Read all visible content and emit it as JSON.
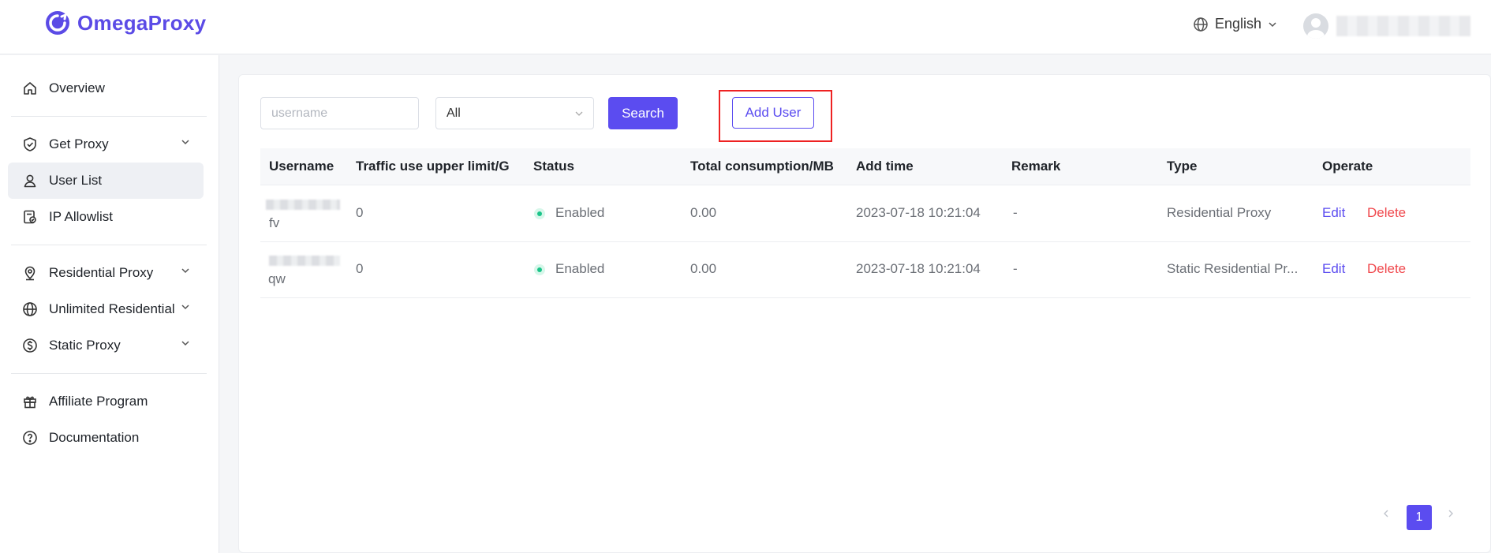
{
  "brand": {
    "name": "OmegaProxy",
    "accent": "#5b4cf0"
  },
  "header": {
    "language": "English"
  },
  "sidebar": {
    "items": [
      {
        "label": "Overview",
        "icon": "home-icon"
      },
      {
        "label": "Get Proxy",
        "icon": "shield-check-icon",
        "expandable": true
      },
      {
        "label": "User List",
        "icon": "user-icon",
        "active": true
      },
      {
        "label": "IP Allowlist",
        "icon": "ip-list-icon"
      },
      {
        "label": "Residential Proxy",
        "icon": "location-pin-icon",
        "expandable": true
      },
      {
        "label": "Unlimited Residential",
        "icon": "globe-icon",
        "expandable": true
      },
      {
        "label": "Static Proxy",
        "icon": "dollar-circle-icon",
        "expandable": true
      },
      {
        "label": "Affiliate Program",
        "icon": "gift-icon"
      },
      {
        "label": "Documentation",
        "icon": "help-circle-icon"
      }
    ]
  },
  "toolbar": {
    "search_placeholder": "username",
    "filter_value": "All",
    "search_label": "Search",
    "add_user_label": "Add User"
  },
  "table": {
    "columns": [
      "Username",
      "Traffic use upper limit/G",
      "Status",
      "Total consumption/MB",
      "Add time",
      "Remark",
      "Type",
      "Operate"
    ],
    "rows": [
      {
        "username": "fv",
        "limit": "0",
        "status": "Enabled",
        "consumption": "0.00",
        "add_time": "2023-07-18 10:21:04",
        "remark": "-",
        "type": "Residential Proxy",
        "edit": "Edit",
        "delete": "Delete"
      },
      {
        "username": "qw",
        "limit": "0",
        "status": "Enabled",
        "consumption": "0.00",
        "add_time": "2023-07-18 10:21:04",
        "remark": "-",
        "type": "Static Residential Pr...",
        "edit": "Edit",
        "delete": "Delete"
      }
    ]
  },
  "pagination": {
    "current_page": "1"
  }
}
